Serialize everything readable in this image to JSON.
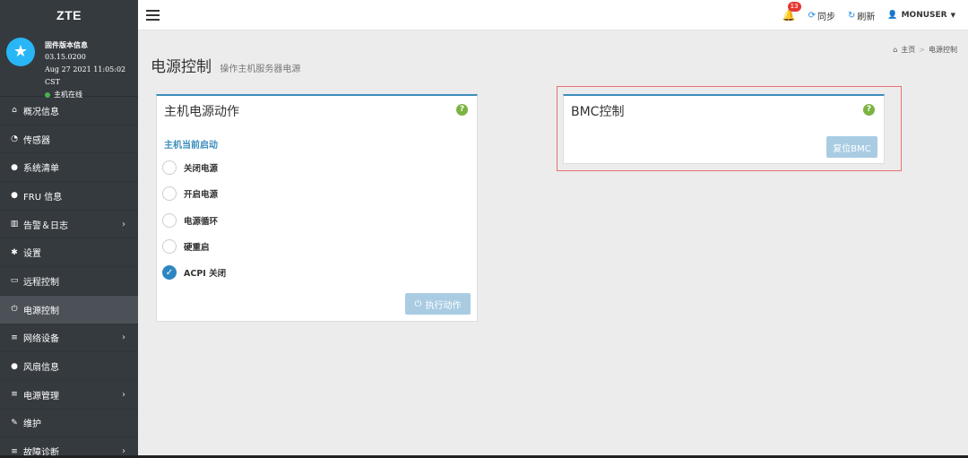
{
  "brand": "ZTE",
  "firmware": {
    "title": "固件版本信息",
    "version": "03.15.0200",
    "date": "Aug 27 2021 11:05:02 CST",
    "status": "主机在线"
  },
  "nav": [
    {
      "label": "概况信息",
      "icon": "home-icon",
      "glyph": "⌂",
      "chevron": false
    },
    {
      "label": "传感器",
      "icon": "dashboard-icon",
      "glyph": "◔",
      "chevron": false
    },
    {
      "label": "系统清单",
      "icon": "info-icon",
      "glyph": "●",
      "chevron": false
    },
    {
      "label": "FRU 信息",
      "icon": "info-icon",
      "glyph": "●",
      "chevron": false
    },
    {
      "label": "告警＆日志",
      "icon": "chart-icon",
      "glyph": "▥",
      "chevron": true
    },
    {
      "label": "设置",
      "icon": "gear-icon",
      "glyph": "✱",
      "chevron": false
    },
    {
      "label": "远程控制",
      "icon": "monitor-icon",
      "glyph": "▭",
      "chevron": false
    },
    {
      "label": "电源控制",
      "icon": "power-icon",
      "glyph": "⏻",
      "chevron": false,
      "active": true
    },
    {
      "label": "网络设备",
      "icon": "database-icon",
      "glyph": "≡",
      "chevron": true
    },
    {
      "label": "风扇信息",
      "icon": "info-icon",
      "glyph": "●",
      "chevron": false
    },
    {
      "label": "电源管理",
      "icon": "database-icon",
      "glyph": "≡",
      "chevron": true
    },
    {
      "label": "维护",
      "icon": "wrench-icon",
      "glyph": "✎",
      "chevron": false
    },
    {
      "label": "故障诊断",
      "icon": "database-icon",
      "glyph": "≡",
      "chevron": true
    }
  ],
  "topbar": {
    "notifications": "13",
    "sync": "同步",
    "refresh": "刷新",
    "user": "MONUSER"
  },
  "page": {
    "title": "电源控制",
    "subtitle": "操作主机服务器电源"
  },
  "breadcrumb": {
    "home": "主页",
    "current": "电源控制"
  },
  "host_power": {
    "title": "主机电源动作",
    "status_label": "主机当前启动",
    "options": [
      "关闭电源",
      "开启电源",
      "电源循环",
      "硬重启",
      "ACPI 关闭"
    ],
    "selected": "ACPI 关闭",
    "execute": "执行动作"
  },
  "bmc": {
    "title": "BMC控制",
    "reset": "复位BMC"
  },
  "colors": {
    "sidebar": "#353a3f",
    "accent": "#3c8dbc",
    "button_disabled": "#a9cce3",
    "help": "#7cb342",
    "highlight": "#e57373"
  }
}
